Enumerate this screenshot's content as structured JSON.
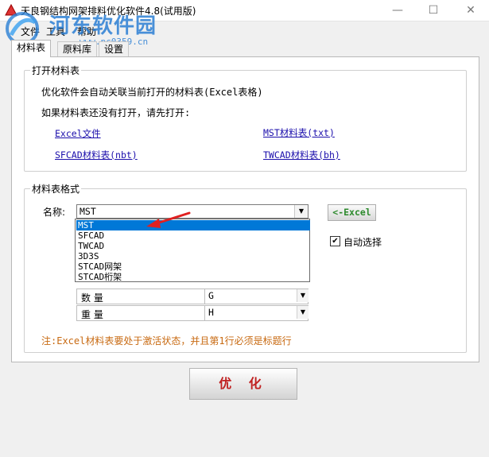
{
  "window": {
    "title": "天良钢结构网架排料优化软件4.8(试用版)",
    "controls": {
      "minimize": "—",
      "maximize": "☐",
      "close": "✕"
    }
  },
  "watermark": {
    "text": "河东软件园",
    "url": "www.pc0359.cn"
  },
  "menu": {
    "file": "文件",
    "tools": "工具",
    "help": "帮助"
  },
  "tabs": [
    {
      "label": "材料表",
      "active": true
    },
    {
      "label": "原料库",
      "active": false
    },
    {
      "label": "设置",
      "active": false
    }
  ],
  "open_group": {
    "title": "打开材料表",
    "line1": "优化软件会自动关联当前打开的材料表(Excel表格)",
    "line2": "如果材料表还没有打开，请先打开:",
    "links": {
      "excel": "Excel文件",
      "mst": "MST材料表(txt)",
      "sfcad": "SFCAD材料表(nbt)",
      "twcad": "TWCAD材料表(bh)"
    }
  },
  "format_group": {
    "title": "材料表格式",
    "name_label": "名称:",
    "name_value": "MST",
    "excel_button": "<-Excel",
    "auto_select_label": "自动选择",
    "auto_select_checked": true,
    "dropdown_options": [
      "MST",
      "SFCAD",
      "TWCAD",
      "3D3S",
      "STCAD网架",
      "STCAD桁架"
    ],
    "dropdown_selected": "MST",
    "rows": [
      {
        "name": "数 量",
        "value": "G"
      },
      {
        "name": "重 量",
        "value": "H"
      }
    ],
    "note": "注:Excel材料表要处于激活状态，并且第1行必须是标题行"
  },
  "optimize_button": "优 化",
  "colors": {
    "link": "#1a0dab",
    "note": "#c86a12",
    "excel_button_text": "#2d8a2d",
    "optimize_text": "#c02020",
    "selection": "#0078d7",
    "arrow": "#e02020"
  }
}
